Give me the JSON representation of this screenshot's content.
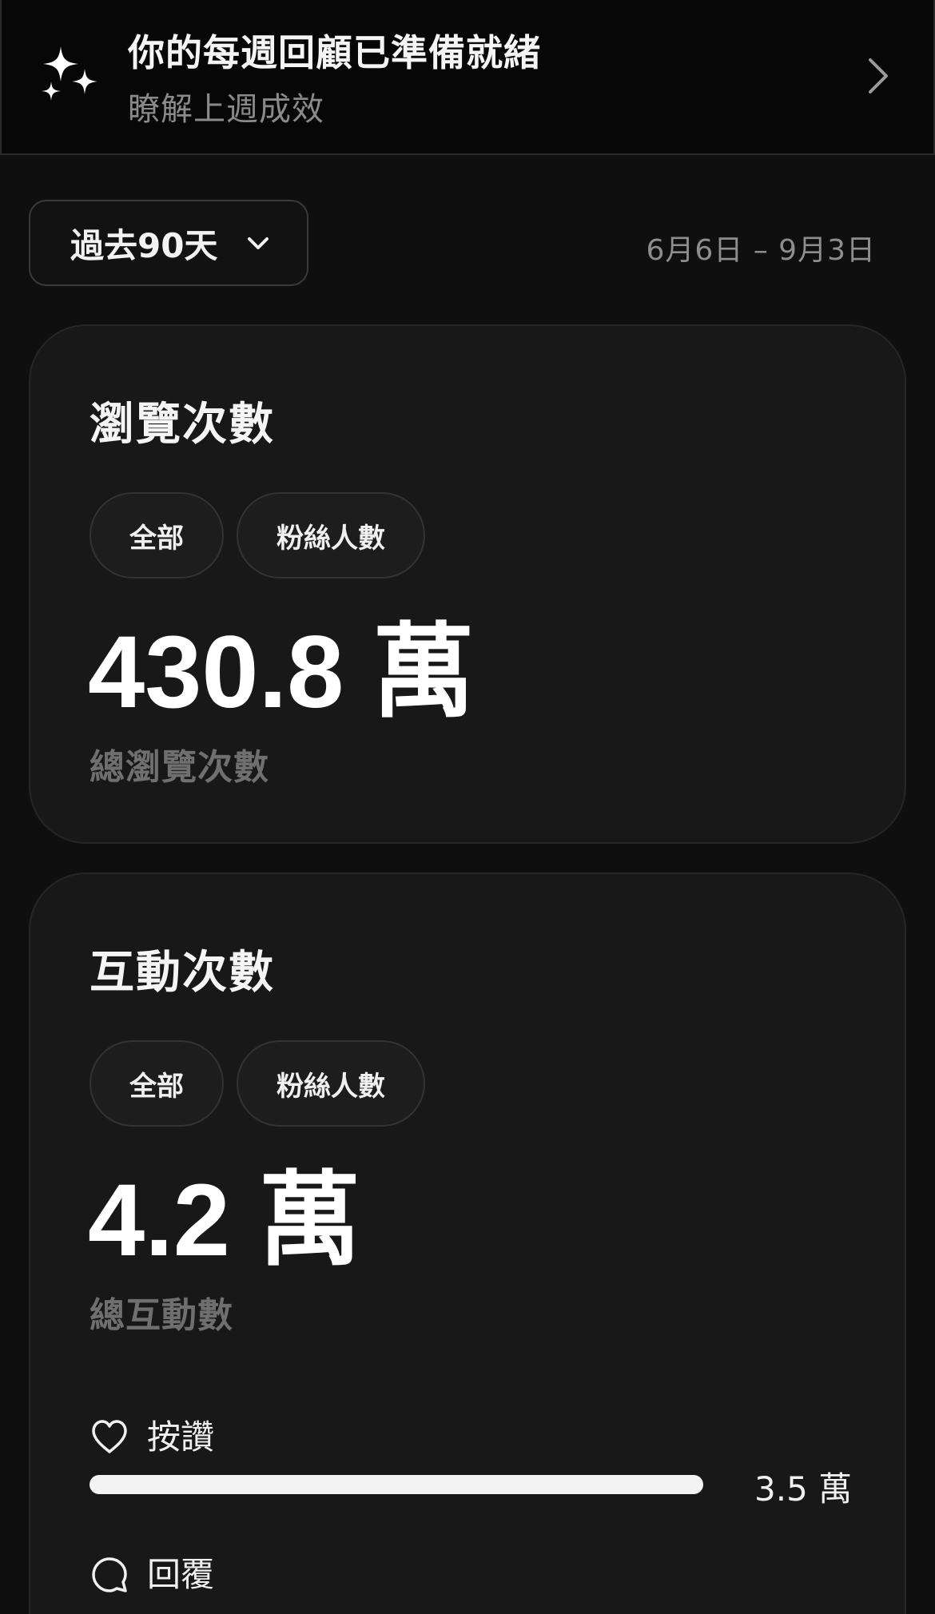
{
  "banner": {
    "title": "你的每週回顧已準備就緒",
    "subtitle": "瞭解上週成效",
    "icon": "sparkles-icon"
  },
  "filter": {
    "range_label": "過去90天",
    "date_range": "6月6日 – 9月3日"
  },
  "views_card": {
    "title": "瀏覽次數",
    "chips": [
      "全部",
      "粉絲人數"
    ],
    "total": "430.8 萬",
    "total_label": "總瀏覽次數"
  },
  "interactions_card": {
    "title": "互動次數",
    "chips": [
      "全部",
      "粉絲人數"
    ],
    "total": "4.2 萬",
    "total_label": "總互動數",
    "metrics": [
      {
        "name": "按讚",
        "value": "3.5 萬",
        "fraction": 1.0,
        "icon": "heart-icon"
      },
      {
        "name": "回覆",
        "icon": "reply-bubble-icon"
      }
    ]
  }
}
